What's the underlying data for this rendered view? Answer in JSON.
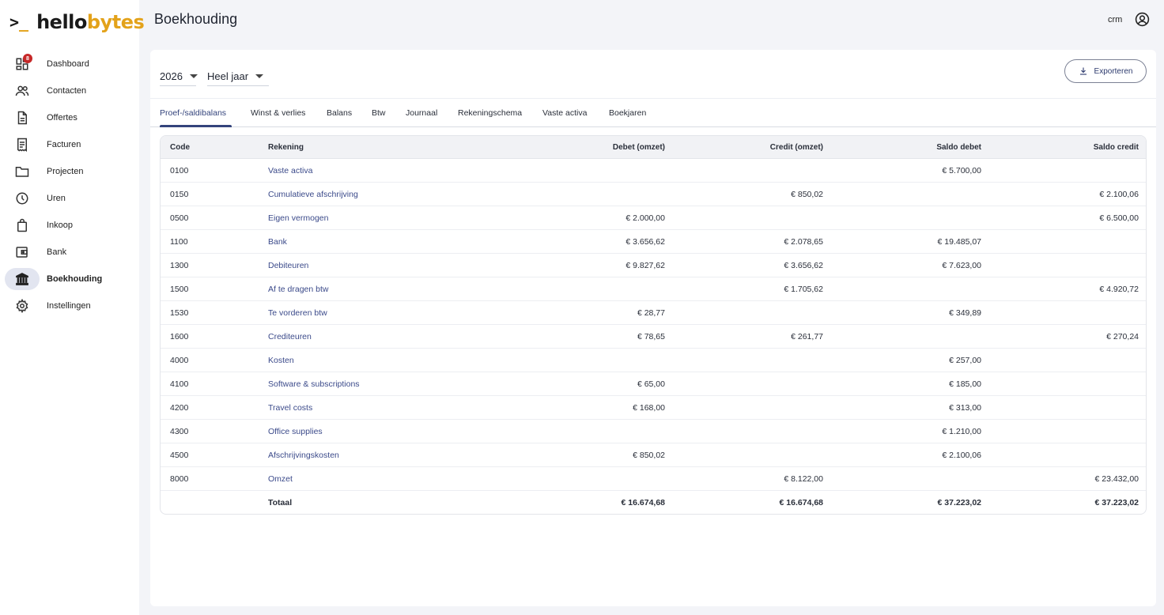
{
  "app": {
    "logo_prompt": ">",
    "logo_underscore": "_",
    "logo_text_a": "hello",
    "logo_text_b": "bytes",
    "brand_color": "#e3a21a",
    "accent_color": "#34447c"
  },
  "sidebar": {
    "items": [
      {
        "label": "Dashboard",
        "icon": "dashboard-icon",
        "badge": "8"
      },
      {
        "label": "Contacten",
        "icon": "people-icon"
      },
      {
        "label": "Offertes",
        "icon": "document-icon"
      },
      {
        "label": "Facturen",
        "icon": "receipt-icon"
      },
      {
        "label": "Projecten",
        "icon": "folder-icon"
      },
      {
        "label": "Uren",
        "icon": "clock-icon"
      },
      {
        "label": "Inkoop",
        "icon": "shopping-bag-icon"
      },
      {
        "label": "Bank",
        "icon": "wallet-icon"
      },
      {
        "label": "Boekhouding",
        "icon": "bank-icon",
        "active": true
      },
      {
        "label": "Instellingen",
        "icon": "gear-icon"
      }
    ]
  },
  "header": {
    "title": "Boekhouding",
    "user": "crm"
  },
  "filters": {
    "year": "2026",
    "period": "Heel jaar"
  },
  "toolbar": {
    "export_label": "Exporteren"
  },
  "tabs": [
    {
      "label": "Proef-/saldibalans",
      "active": true
    },
    {
      "label": "Winst & verlies"
    },
    {
      "label": "Balans"
    },
    {
      "label": "Btw"
    },
    {
      "label": "Journaal"
    },
    {
      "label": "Rekeningschema"
    },
    {
      "label": "Vaste activa"
    },
    {
      "label": "Boekjaren"
    }
  ],
  "table": {
    "headers": {
      "code": "Code",
      "account": "Rekening",
      "debit": "Debet (omzet)",
      "credit": "Credit (omzet)",
      "balance_debit": "Saldo debet",
      "balance_credit": "Saldo credit"
    },
    "rows": [
      {
        "code": "0100",
        "account": "Vaste activa",
        "debit": "",
        "credit": "",
        "balance_debit": "€ 5.700,00",
        "balance_credit": ""
      },
      {
        "code": "0150",
        "account": "Cumulatieve afschrijving",
        "debit": "",
        "credit": "€ 850,02",
        "balance_debit": "",
        "balance_credit": "€ 2.100,06"
      },
      {
        "code": "0500",
        "account": "Eigen vermogen",
        "debit": "€ 2.000,00",
        "credit": "",
        "balance_debit": "",
        "balance_credit": "€ 6.500,00"
      },
      {
        "code": "1100",
        "account": "Bank",
        "debit": "€ 3.656,62",
        "credit": "€ 2.078,65",
        "balance_debit": "€ 19.485,07",
        "balance_credit": ""
      },
      {
        "code": "1300",
        "account": "Debiteuren",
        "debit": "€ 9.827,62",
        "credit": "€ 3.656,62",
        "balance_debit": "€ 7.623,00",
        "balance_credit": ""
      },
      {
        "code": "1500",
        "account": "Af te dragen btw",
        "debit": "",
        "credit": "€ 1.705,62",
        "balance_debit": "",
        "balance_credit": "€ 4.920,72"
      },
      {
        "code": "1530",
        "account": "Te vorderen btw",
        "debit": "€ 28,77",
        "credit": "",
        "balance_debit": "€ 349,89",
        "balance_credit": ""
      },
      {
        "code": "1600",
        "account": "Crediteuren",
        "debit": "€ 78,65",
        "credit": "€ 261,77",
        "balance_debit": "",
        "balance_credit": "€ 270,24"
      },
      {
        "code": "4000",
        "account": "Kosten",
        "debit": "",
        "credit": "",
        "balance_debit": "€ 257,00",
        "balance_credit": ""
      },
      {
        "code": "4100",
        "account": "Software & subscriptions",
        "debit": "€ 65,00",
        "credit": "",
        "balance_debit": "€ 185,00",
        "balance_credit": ""
      },
      {
        "code": "4200",
        "account": "Travel costs",
        "debit": "€ 168,00",
        "credit": "",
        "balance_debit": "€ 313,00",
        "balance_credit": ""
      },
      {
        "code": "4300",
        "account": "Office supplies",
        "debit": "",
        "credit": "",
        "balance_debit": "€ 1.210,00",
        "balance_credit": ""
      },
      {
        "code": "4500",
        "account": "Afschrijvingskosten",
        "debit": "€ 850,02",
        "credit": "",
        "balance_debit": "€ 2.100,06",
        "balance_credit": ""
      },
      {
        "code": "8000",
        "account": "Omzet",
        "debit": "",
        "credit": "€ 8.122,00",
        "balance_debit": "",
        "balance_credit": "€ 23.432,00"
      }
    ],
    "total": {
      "label": "Totaal",
      "debit": "€ 16.674,68",
      "credit": "€ 16.674,68",
      "balance_debit": "€ 37.223,02",
      "balance_credit": "€ 37.223,02"
    }
  }
}
